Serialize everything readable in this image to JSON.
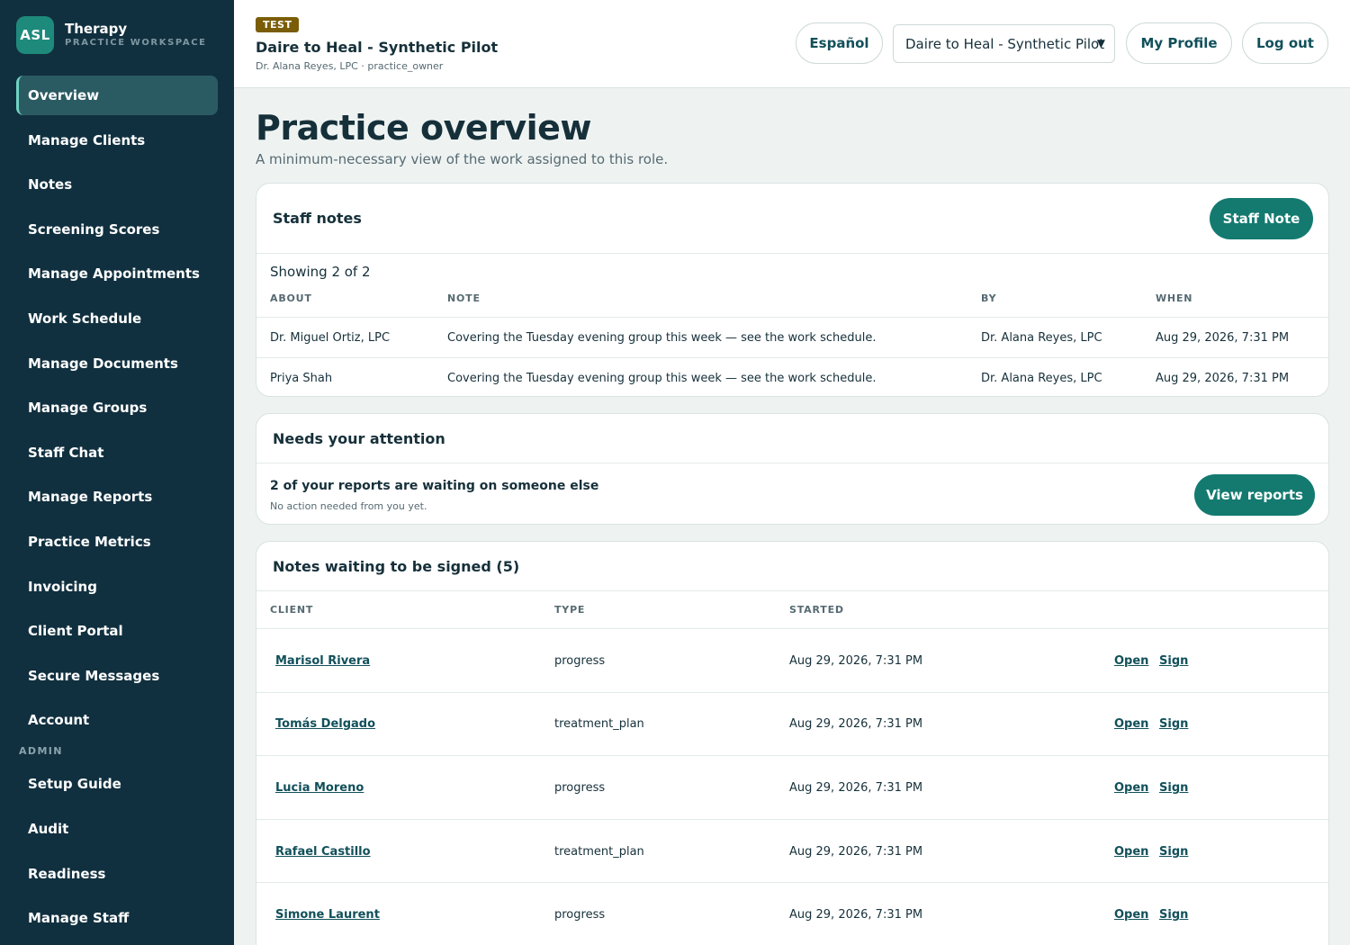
{
  "brand": {
    "logo": "ASL",
    "name": "Therapy",
    "sub": "PRACTICE WORKSPACE"
  },
  "sidebar": {
    "items": [
      {
        "label": "Overview"
      },
      {
        "label": "Manage Clients"
      },
      {
        "label": "Notes"
      },
      {
        "label": "Screening Scores"
      },
      {
        "label": "Manage Appointments"
      },
      {
        "label": "Work Schedule"
      },
      {
        "label": "Manage Documents"
      },
      {
        "label": "Manage Groups"
      },
      {
        "label": "Staff Chat"
      },
      {
        "label": "Manage Reports"
      },
      {
        "label": "Practice Metrics"
      },
      {
        "label": "Invoicing"
      },
      {
        "label": "Client Portal"
      },
      {
        "label": "Secure Messages"
      },
      {
        "label": "Account"
      }
    ],
    "admin_label": "ADMIN",
    "admin_items": [
      {
        "label": "Setup Guide"
      },
      {
        "label": "Audit"
      },
      {
        "label": "Readiness"
      },
      {
        "label": "Manage Staff"
      }
    ]
  },
  "header": {
    "badge": "TEST",
    "practice_name": "Daire to Heal - Synthetic Pilot",
    "user_line": "Dr. Alana Reyes, LPC · practice_owner",
    "language_button": "Español",
    "practice_select": "Daire to Heal - Synthetic Pilot",
    "profile_button": "My Profile",
    "logout_button": "Log out"
  },
  "main": {
    "title": "Practice overview",
    "subtitle": "A minimum-necessary view of the work assigned to this role."
  },
  "staff_notes": {
    "title": "Staff notes",
    "button": "Staff Note",
    "showing": "Showing 2 of 2",
    "columns": [
      "ABOUT",
      "NOTE",
      "BY",
      "WHEN"
    ],
    "rows": [
      {
        "about": "Dr. Miguel Ortiz, LPC",
        "note": "Covering the Tuesday evening group this week — see the work schedule.",
        "by": "Dr. Alana Reyes, LPC",
        "when": "Aug 29, 2026, 7:31 PM"
      },
      {
        "about": "Priya Shah",
        "note": "Covering the Tuesday evening group this week — see the work schedule.",
        "by": "Dr. Alana Reyes, LPC",
        "when": "Aug 29, 2026, 7:31 PM"
      }
    ]
  },
  "attention": {
    "title": "Needs your attention",
    "message": "2 of your reports are waiting on someone else",
    "detail": "No action needed from you yet.",
    "button": "View reports"
  },
  "unsigned": {
    "title": "Notes waiting to be signed (5)",
    "columns": [
      "CLIENT",
      "TYPE",
      "STARTED"
    ],
    "open_label": "Open",
    "sign_label": "Sign",
    "rows": [
      {
        "client": "Marisol Rivera",
        "type": "progress",
        "started": "Aug 29, 2026, 7:31 PM"
      },
      {
        "client": "Tomás Delgado",
        "type": "treatment_plan",
        "started": "Aug 29, 2026, 7:31 PM"
      },
      {
        "client": "Lucia Moreno",
        "type": "progress",
        "started": "Aug 29, 2026, 7:31 PM"
      },
      {
        "client": "Rafael Castillo",
        "type": "treatment_plan",
        "started": "Aug 29, 2026, 7:31 PM"
      },
      {
        "client": "Simone Laurent",
        "type": "progress",
        "started": "Aug 29, 2026, 7:31 PM"
      }
    ]
  },
  "colors": {
    "sidebar_bg": "#11303f",
    "accent": "#147a70",
    "active_nav": "#2b5b62",
    "badge": "#7a5d07"
  }
}
